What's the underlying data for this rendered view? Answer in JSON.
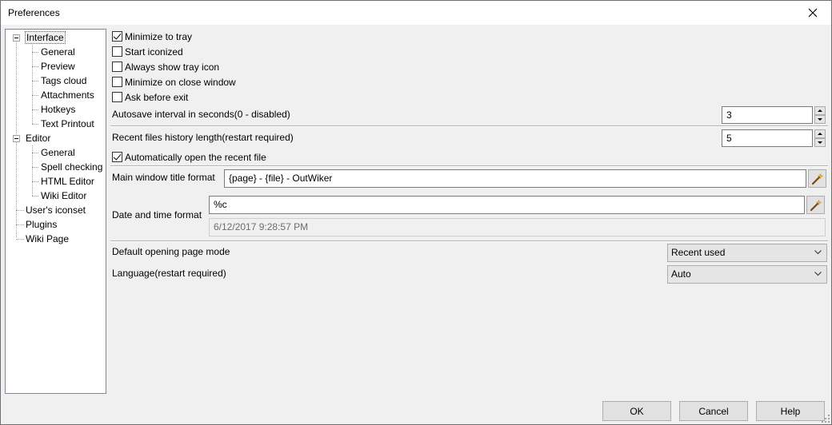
{
  "window": {
    "title": "Preferences"
  },
  "tree": {
    "items": [
      {
        "label": "Interface"
      },
      {
        "label": "General"
      },
      {
        "label": "Preview"
      },
      {
        "label": "Tags cloud"
      },
      {
        "label": "Attachments"
      },
      {
        "label": "Hotkeys"
      },
      {
        "label": "Text Printout"
      },
      {
        "label": "Editor"
      },
      {
        "label": "General"
      },
      {
        "label": "Spell checking"
      },
      {
        "label": "HTML Editor"
      },
      {
        "label": "Wiki Editor"
      },
      {
        "label": "User's iconset"
      },
      {
        "label": "Plugins"
      },
      {
        "label": "Wiki Page"
      }
    ],
    "selected": "Interface"
  },
  "options": {
    "minimize_to_tray": {
      "label": "Minimize to tray",
      "checked": true
    },
    "start_iconized": {
      "label": "Start iconized",
      "checked": false
    },
    "always_show_tray_icon": {
      "label": "Always show tray icon",
      "checked": false
    },
    "minimize_on_close": {
      "label": "Minimize on close window",
      "checked": false
    },
    "ask_before_exit": {
      "label": "Ask before exit",
      "checked": false
    },
    "autosave": {
      "label": "Autosave interval in seconds(0 - disabled)",
      "value": "3"
    },
    "recent_files": {
      "label": "Recent files history length(restart required)",
      "value": "5"
    },
    "auto_open_recent": {
      "label": "Automatically open the recent file",
      "checked": true
    },
    "title_format": {
      "label": "Main window title format",
      "value": "{page} - {file} - OutWiker"
    },
    "date_format": {
      "label": "Date and time format",
      "value": "%c",
      "preview": "6/12/2017 9:28:57 PM"
    },
    "default_page_mode": {
      "label": "Default opening page mode",
      "value": "Recent used"
    },
    "language": {
      "label": "Language(restart required)",
      "value": "Auto"
    }
  },
  "buttons": {
    "ok": "OK",
    "cancel": "Cancel",
    "help": "Help"
  },
  "icons": {
    "close": "close-icon",
    "wand": "magic-wand-icon",
    "expander": "tree-collapse-icon",
    "chevron": "chevron-down-icon",
    "grip": "resize-grip-icon"
  }
}
